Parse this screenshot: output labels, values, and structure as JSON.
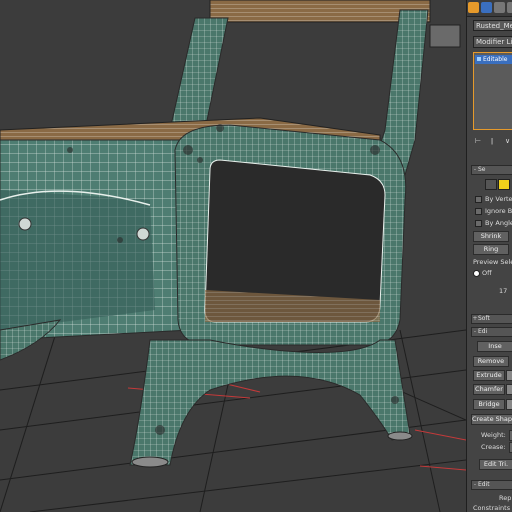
{
  "viewport": {
    "background": "#3a3a3a",
    "mesh_color": "#4e7d72",
    "wire_color": "#e8f0ec",
    "wood_color": "#8a6a45"
  },
  "panel": {
    "object_name": "Rusted_Meta",
    "modifier_list_label": "Modifier List",
    "stack_item_label": "Editable",
    "rollout_selection": "Se",
    "selection_checks": [
      "By Verte",
      "Ignore B",
      "By Angle"
    ],
    "shrink_label": "Shrink",
    "ring_label": "Ring",
    "preview_label": "Preview Sele",
    "off_label": "Off",
    "count_label": "17",
    "soft_label": "Soft",
    "edit_edges_label": "Edi",
    "insert_label": "Inse",
    "remove_label": "Remove",
    "extrude_label": "Extrude",
    "chamfer_label": "Chamfer",
    "bridge_label": "Bridge",
    "create_shape_label": "Create Shap",
    "weight_label": "Weight:",
    "crease_label": "Crease:",
    "edit_tri_label": "Edit Tri.",
    "edit_geom_label": "Edit",
    "rep_label": "Rep",
    "constraints_label": "Constraints"
  },
  "colors": {
    "accent": "#e69a2b",
    "selection_blue": "#3a6fbf",
    "yellow_icon": "#f2d21b"
  }
}
